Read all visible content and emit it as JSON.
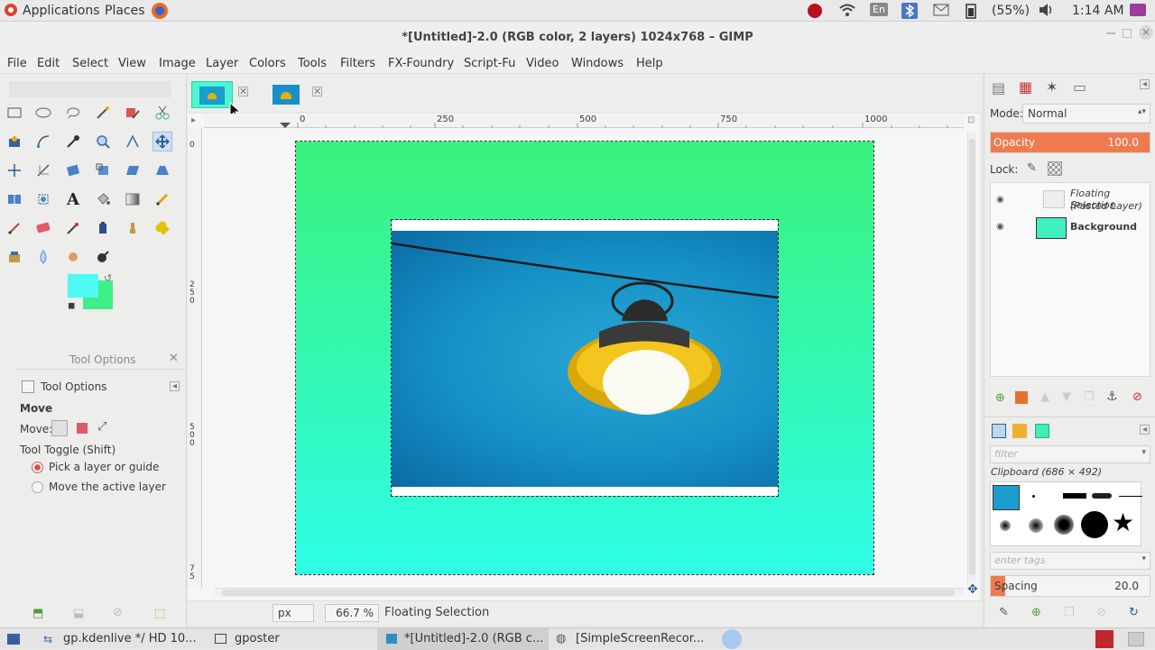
{
  "top_panel": {
    "applications": "Applications",
    "places": "Places",
    "lang": "En",
    "battery": "(55%)",
    "time": "1:14 AM"
  },
  "window": {
    "title": "*[Untitled]-2.0 (RGB color, 2 layers) 1024x768 – GIMP"
  },
  "menu": [
    "File",
    "Edit",
    "Select",
    "View",
    "Image",
    "Layer",
    "Colors",
    "Tools",
    "Filters",
    "FX-Foundry",
    "Script-Fu",
    "Video",
    "Windows",
    "Help"
  ],
  "ruler": {
    "h": [
      "0",
      "250",
      "500",
      "750",
      "1000"
    ]
  },
  "tool_options": {
    "panel_title": "Tool Options",
    "tab_label": "Tool Options",
    "tool_name": "Move",
    "move_label": "Move:",
    "toggle": "Tool Toggle  (Shift)",
    "opt1": "Pick a layer or guide",
    "opt2": "Move the active layer"
  },
  "status": {
    "unit": "px",
    "zoom": "66.7 %",
    "text": "Floating Selection"
  },
  "layers": {
    "mode_label": "Mode:",
    "mode_value": "Normal",
    "opacity_label": "Opacity",
    "opacity_value": "100.0",
    "opacity_fraction": 1.0,
    "lock_label": "Lock:",
    "items": [
      {
        "name_line1": "Floating Selection",
        "name_line2": "(Pasted Layer)"
      },
      {
        "name_line1": "Background",
        "name_line2": ""
      }
    ]
  },
  "brushes": {
    "filter_placeholder": "filter",
    "clipboard": "Clipboard (686 × 492)",
    "tags_placeholder": "enter tags",
    "spacing_label": "Spacing",
    "spacing_value": "20.0"
  },
  "taskbar": {
    "items": [
      "gp.kdenlive */ HD 10...",
      "gposter",
      "*[Untitled]-2.0 (RGB c...",
      "[SimpleScreenRecor..."
    ]
  },
  "colors": {
    "canvas_top": "#3af27a",
    "canvas_bottom": "#2efde8",
    "fg": "#4dfbf2",
    "bg": "#40ef87",
    "opacity_fill": "#f07a50"
  }
}
